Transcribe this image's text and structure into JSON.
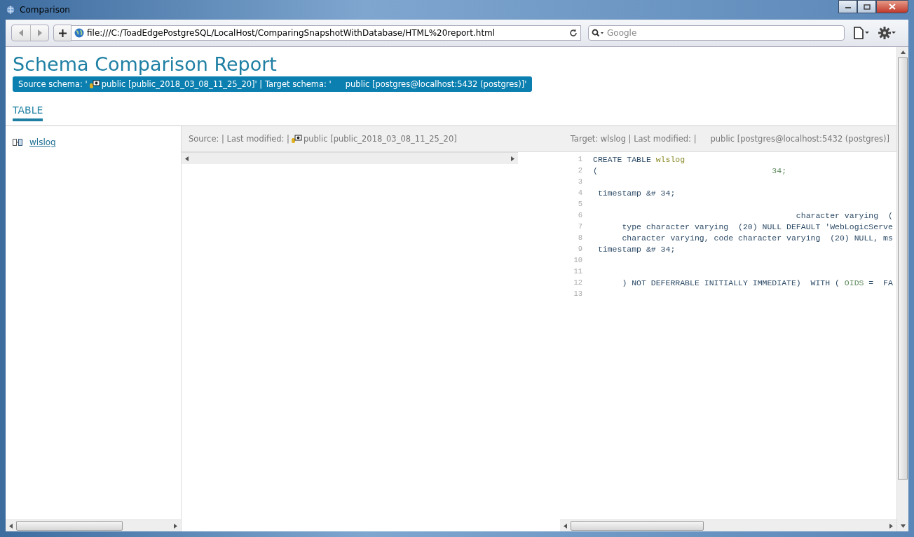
{
  "window": {
    "title": "Comparison"
  },
  "browser": {
    "address": "file:///C:/ToadEdgePostgreSQL/LocalHost/ComparingSnapshotWithDatabase/HTML%20report.html",
    "search_placeholder": "Google"
  },
  "report": {
    "heading": "Schema Comparison Report",
    "schema_bar": {
      "source_label": "Source schema: '",
      "source_value": "public [public_2018_03_08_11_25_20]' | Target schema: '",
      "target_value": "public [postgres@localhost:5432 (postgres)]'"
    },
    "tabs": [
      {
        "label": "TABLE",
        "selected": true
      }
    ],
    "objects": [
      {
        "label": "wlslog"
      }
    ],
    "source_header": {
      "label": "Source: | Last modified: |",
      "value": "public [public_2018_03_08_11_25_20]"
    },
    "target_header": {
      "label": "Target: wlslog | Last modified: |",
      "value": "public [postgres@localhost:5432 (postgres)]"
    },
    "code_lines": [
      {
        "number": "1",
        "segments": [
          {
            "text": "CREATE TABLE ",
            "kind": "keyword"
          },
          {
            "text": "wlslog",
            "kind": "name"
          }
        ]
      },
      {
        "number": "2",
        "segments": [
          {
            "text": "(                                    ",
            "kind": "keyword"
          },
          {
            "text": "34;",
            "kind": "value"
          }
        ]
      },
      {
        "number": "3"
      },
      {
        "number": "4",
        "segments": [
          {
            "text": " timestamp &# 34;",
            "kind": "keyword"
          }
        ]
      },
      {
        "number": "5"
      },
      {
        "number": "6",
        "segments": [
          {
            "text": "                                          character varying  (",
            "kind": "keyword"
          }
        ]
      },
      {
        "number": "7",
        "segments": [
          {
            "text": "      type character varying  (20) NULL DEFAULT 'WebLogicServe",
            "kind": "keyword"
          }
        ]
      },
      {
        "number": "8",
        "segments": [
          {
            "text": "      character varying, code character varying  (20) NULL, ms",
            "kind": "keyword"
          }
        ]
      },
      {
        "number": "9",
        "segments": [
          {
            "text": " timestamp &# 34;",
            "kind": "keyword"
          }
        ]
      },
      {
        "number": "10"
      },
      {
        "number": "11"
      },
      {
        "number": "12",
        "segments": [
          {
            "text": "      ) NOT DEFERRABLE INITIALLY IMMEDIATE)  WITH ( ",
            "kind": "keyword"
          },
          {
            "text": "OIDS",
            "kind": "value"
          },
          {
            "text": " =  FA",
            "kind": "keyword"
          }
        ]
      },
      {
        "number": "13"
      }
    ]
  }
}
